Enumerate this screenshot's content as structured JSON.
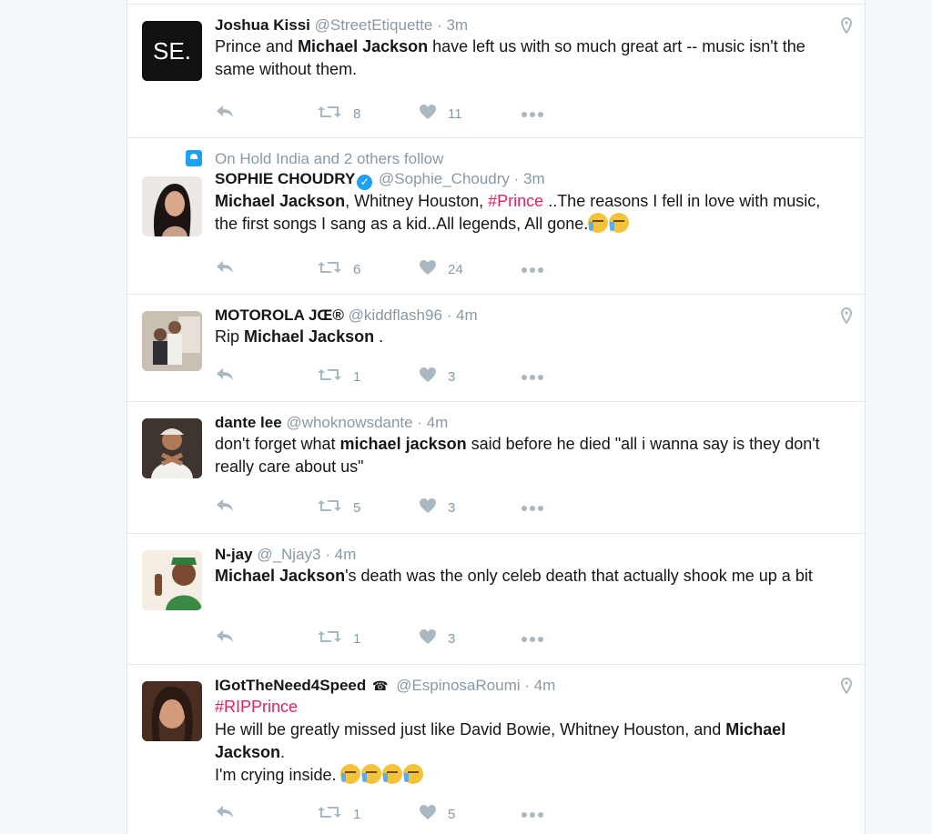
{
  "tweets": [
    {
      "name": "Joshua Kissi",
      "handle": "@StreetEtiquette",
      "time": "· 3m",
      "avatar_text": "SE.",
      "parts": [
        {
          "t": "Prince and "
        },
        {
          "b": "Michael Jackson"
        },
        {
          "t": " have left us with so much great art -- music isn't the same without them."
        }
      ],
      "retweets": "8",
      "likes": "11"
    },
    {
      "context": "On Hold India and 2 others follow",
      "name": "SOPHIE CHOUDRY",
      "handle": "@Sophie_Choudry",
      "time": "· 3m",
      "parts": [
        {
          "b": "Michael Jackson"
        },
        {
          "t": ", Whitney Houston, "
        },
        {
          "h": "#Prince"
        },
        {
          "t": " ..The reasons I fell in love with music, the first songs I sang as a kid..All legends, All gone."
        }
      ],
      "retweets": "6",
      "likes": "24"
    },
    {
      "name": "MOTOROLA JŒ®",
      "handle": "@kiddflash96",
      "time": "· 4m",
      "parts": [
        {
          "t": "Rip "
        },
        {
          "b": "Michael Jackson"
        },
        {
          "t": " ."
        }
      ],
      "retweets": "1",
      "likes": "3"
    },
    {
      "name": "dante lee",
      "handle": "@whoknowsdante",
      "time": "· 4m",
      "parts": [
        {
          "t": "don't forget what "
        },
        {
          "b": "michael jackson"
        },
        {
          "t": " said before he died \"all i wanna say is they don't really care about us\""
        }
      ],
      "retweets": "5",
      "likes": "3"
    },
    {
      "name": "N-jay",
      "handle": "@_Njay3",
      "time": "· 4m",
      "parts": [
        {
          "b": "Michael Jackson"
        },
        {
          "t": "'s death was the only celeb death that actually shook me up a bit"
        }
      ],
      "retweets": "1",
      "likes": "3"
    },
    {
      "name": "IGotTheNeed4Speed",
      "name_suffix": "☎",
      "handle": "@EspinosaRoumi",
      "time": "· 4m",
      "parts": [
        {
          "h": "#RIPPrince"
        },
        {
          "br": true
        },
        {
          "t": "He will be greatly missed just like David Bowie, Whitney Houston, and "
        },
        {
          "b": "Michael Jackson"
        },
        {
          "t": "."
        },
        {
          "br": true
        },
        {
          "t": "I'm crying inside. "
        }
      ],
      "retweets": "1",
      "likes": "5"
    }
  ],
  "colors": {
    "hashtag": "#e0245e",
    "muted": "#8899a6",
    "verified": "#1da1f2"
  },
  "icons": [
    "reply-icon",
    "retweet-icon",
    "like-icon",
    "more-icon",
    "geo-pin-icon",
    "verified-icon"
  ]
}
